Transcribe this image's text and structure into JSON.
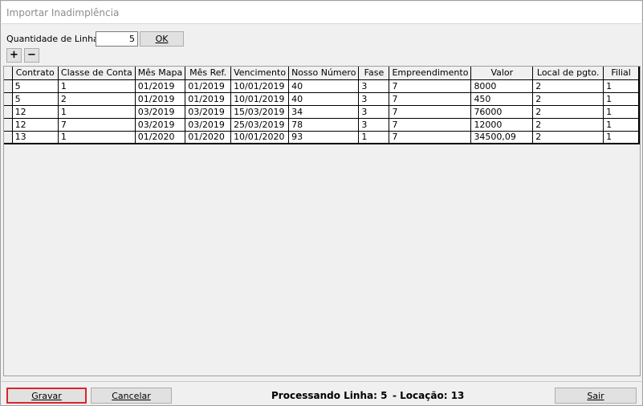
{
  "window": {
    "title": "Importar Inadimplência"
  },
  "toolbar": {
    "qty_label": "Quantidade de Linhas:",
    "qty_value": "5",
    "ok_label": "OK",
    "add_label": "+",
    "remove_label": "−"
  },
  "grid": {
    "columns": [
      "Contrato",
      "Classe de Conta",
      "Mês Mapa",
      "Mês Ref.",
      "Vencimento",
      "Nosso Número",
      "Fase",
      "Empreendimento",
      "Valor",
      "Local de pgto.",
      "Filial"
    ],
    "rows": [
      [
        "5",
        "1",
        "01/2019",
        "01/2019",
        "10/01/2019",
        "40",
        "3",
        "7",
        "8000",
        "2",
        "1"
      ],
      [
        "5",
        "2",
        "01/2019",
        "01/2019",
        "10/01/2019",
        "40",
        "3",
        "7",
        "450",
        "2",
        "1"
      ],
      [
        "12",
        "1",
        "03/2019",
        "03/2019",
        "15/03/2019",
        "34",
        "3",
        "7",
        "76000",
        "2",
        "1"
      ],
      [
        "12",
        "7",
        "03/2019",
        "03/2019",
        "25/03/2019",
        "78",
        "3",
        "7",
        "12000",
        "2",
        "1"
      ],
      [
        "13",
        "1",
        "01/2020",
        "01/2020",
        "10/01/2020",
        "93",
        "1",
        "7",
        "34500,09",
        "2",
        "1"
      ]
    ]
  },
  "footer": {
    "gravar_label": "Gravar",
    "cancelar_label": "Cancelar",
    "sair_label": "Sair",
    "status_linha": "Processando Linha: 5",
    "status_locacao": "- Locação: 13"
  },
  "colors": {
    "highlight_border": "#d9262a",
    "title_text": "#8c8c8c"
  }
}
